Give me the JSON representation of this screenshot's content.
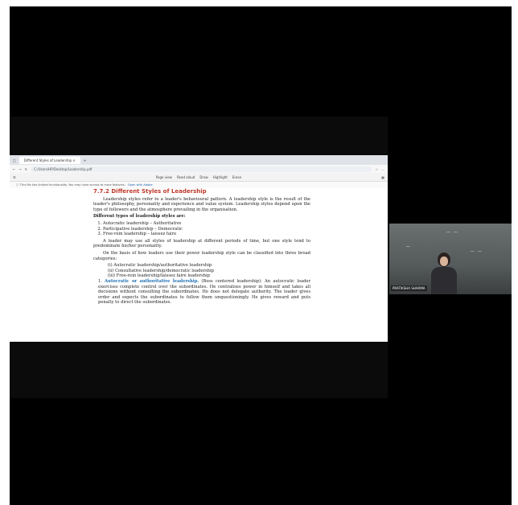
{
  "browser": {
    "tab_title": "Different Styles of Leadership",
    "url": "C:/Users/HP/Desktop/Leadership.pdf",
    "toolbar": {
      "page_view": "Page view",
      "read_aloud": "Read aloud",
      "draw": "Draw",
      "highlight": "Highlight",
      "erase": "Erase"
    },
    "notice": "This file has limited functionality. You may have access to more features.",
    "notice_link": "Open with Adobe"
  },
  "doc": {
    "section_title": "7.7.2 Different Styles of Leadership",
    "intro": "Leadership styles refer to a leader's behavioural pattern. A leadership style is the result of the leader's philosophy, personality and experience and value system. Leadership styles depend upon the type of followers and the atmosphere prevailing in the organisation.",
    "types_heading": "Different types of leadership styles are:",
    "types": [
      "Autocratic leadership – Authoritative",
      "Participative leadership – Democratic",
      "Free-rein leadership – laissez faire"
    ],
    "para2": "A leader may use all styles of leadership at different periods of time, but one style tend to predominate his/her personality.",
    "para3": "On the basis of how leaders use their power leadership style can be classified into three broad categories:",
    "categories": [
      "(i) Autocratic leadership/authoritative leadership",
      "(ii) Consultative leadership/democratic leadership",
      "(iii) Free-rein leadership/laissez faire leadership"
    ],
    "item1_num": "1.",
    "item1_term": "Autocratic or authoritative leadership.",
    "item1_text": "(Boss centered leadership): An autocratic leader exercises complete control over the subordinates. He centralises power in himself and takes all decisions without consulting the subordinates. He does not delegate authority. The leader gives order and expects the subordinates to follow them unquestioningly. He gives reward and puts penalty to direct the subordinates."
  },
  "video": {
    "participant_name": "PRATIKSHA SHARMA"
  }
}
